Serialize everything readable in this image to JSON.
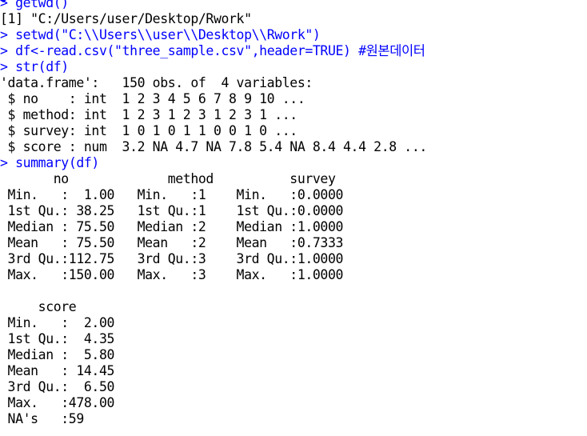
{
  "console": {
    "prompt": "> ",
    "lines": [
      {
        "type": "cmd",
        "text": "getwd()"
      },
      {
        "type": "out",
        "text": "[1] \"C:/Users/user/Desktop/Rwork\""
      },
      {
        "type": "cmd",
        "text": "setwd(\"C:\\\\Users\\\\user\\\\Desktop\\\\Rwork\")"
      },
      {
        "type": "cmd",
        "text": "df<-read.csv(\"three_sample.csv\",header=TRUE) #원본데이터"
      },
      {
        "type": "cmd",
        "text": "str(df)"
      },
      {
        "type": "out",
        "text": "'data.frame':   150 obs. of  4 variables:"
      },
      {
        "type": "out",
        "text": " $ no    : int  1 2 3 4 5 6 7 8 9 10 ..."
      },
      {
        "type": "out",
        "text": " $ method: int  1 2 3 1 2 3 1 2 3 1 ..."
      },
      {
        "type": "out",
        "text": " $ survey: int  1 0 1 0 1 1 0 0 1 0 ..."
      },
      {
        "type": "out",
        "text": " $ score : num  3.2 NA 4.7 NA 7.8 5.4 NA 8.4 4.4 2.8 ..."
      },
      {
        "type": "cmd",
        "text": "summary(df)"
      },
      {
        "type": "out",
        "text": "       no             method          survey      "
      },
      {
        "type": "out",
        "text": " Min.   :  1.00   Min.   :1    Min.   :0.0000  "
      },
      {
        "type": "out",
        "text": " 1st Qu.: 38.25   1st Qu.:1    1st Qu.:0.0000  "
      },
      {
        "type": "out",
        "text": " Median : 75.50   Median :2    Median :1.0000  "
      },
      {
        "type": "out",
        "text": " Mean   : 75.50   Mean   :2    Mean   :0.7333  "
      },
      {
        "type": "out",
        "text": " 3rd Qu.:112.75   3rd Qu.:3    3rd Qu.:1.0000  "
      },
      {
        "type": "out",
        "text": " Max.   :150.00   Max.   :3    Max.   :1.0000  "
      },
      {
        "type": "out",
        "text": "                                                "
      },
      {
        "type": "out",
        "text": "     score       "
      },
      {
        "type": "out",
        "text": " Min.   :  2.00  "
      },
      {
        "type": "out",
        "text": " 1st Qu.:  4.35  "
      },
      {
        "type": "out",
        "text": " Median :  5.80  "
      },
      {
        "type": "out",
        "text": " Mean   : 14.45  "
      },
      {
        "type": "out",
        "text": " 3rd Qu.:  6.50  "
      },
      {
        "type": "out",
        "text": " Max.   :478.00  "
      },
      {
        "type": "out",
        "text": " NA's   :59      "
      }
    ]
  },
  "colors": {
    "command": "#0000ff",
    "output": "#000000",
    "background": "#ffffff"
  }
}
